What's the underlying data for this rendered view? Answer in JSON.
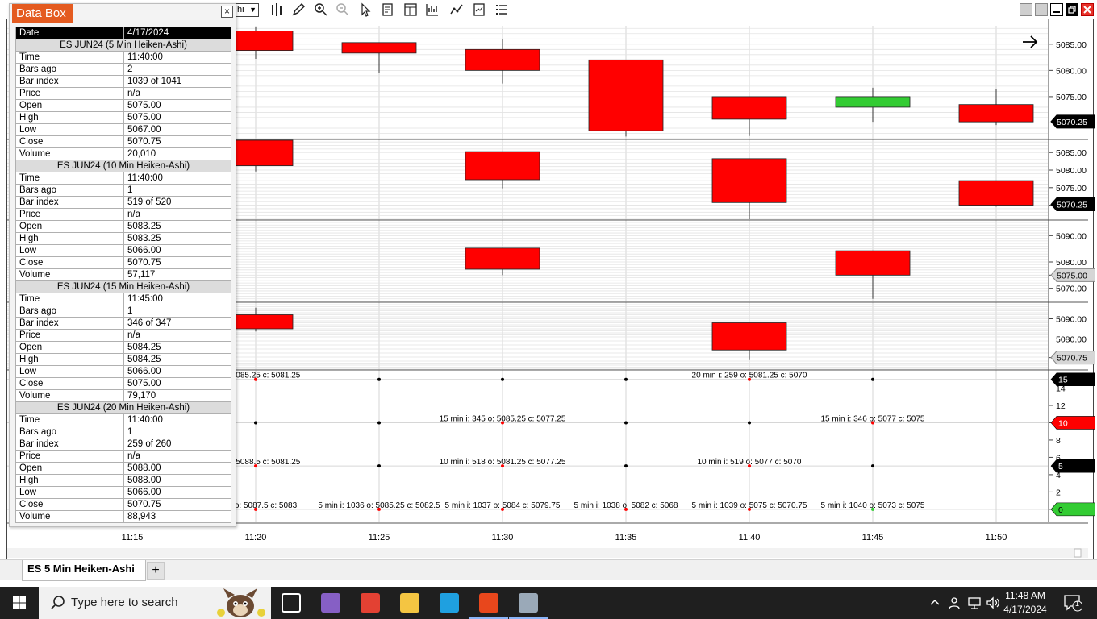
{
  "toolbar": {
    "select_value": "hi",
    "icons": [
      "bar-chart-icon",
      "pencil-icon",
      "zoom-in-icon",
      "zoom-out-icon",
      "pointer-icon",
      "properties-icon",
      "templates-icon",
      "strategy-icon",
      "indicator-icon",
      "data-box-icon",
      "list-icon"
    ],
    "window_buttons": [
      "restore-icon",
      "restore-icon",
      "minimize-icon",
      "maximize-icon",
      "close-icon"
    ]
  },
  "databox": {
    "title": "Data Box",
    "close_glyph": "×",
    "header": {
      "label": "Date",
      "value": "4/17/2024"
    },
    "sections": [
      {
        "title": "ES JUN24 (5 Min Heiken-Ashi)",
        "rows": [
          [
            "Time",
            "11:40:00"
          ],
          [
            "Bars ago",
            "2"
          ],
          [
            "Bar index",
            "1039 of 1041"
          ],
          [
            "Price",
            "n/a"
          ],
          [
            "Open",
            "5075.00"
          ],
          [
            "High",
            "5075.00"
          ],
          [
            "Low",
            "5067.00"
          ],
          [
            "Close",
            "5070.75"
          ],
          [
            "Volume",
            "20,010"
          ]
        ]
      },
      {
        "title": "ES JUN24 (10 Min Heiken-Ashi)",
        "rows": [
          [
            "Time",
            "11:40:00"
          ],
          [
            "Bars ago",
            "1"
          ],
          [
            "Bar index",
            "519 of 520"
          ],
          [
            "Price",
            "n/a"
          ],
          [
            "Open",
            "5083.25"
          ],
          [
            "High",
            "5083.25"
          ],
          [
            "Low",
            "5066.00"
          ],
          [
            "Close",
            "5070.75"
          ],
          [
            "Volume",
            "57,117"
          ]
        ]
      },
      {
        "title": "ES JUN24 (15 Min Heiken-Ashi)",
        "rows": [
          [
            "Time",
            "11:45:00"
          ],
          [
            "Bars ago",
            "1"
          ],
          [
            "Bar index",
            "346 of 347"
          ],
          [
            "Price",
            "n/a"
          ],
          [
            "Open",
            "5084.25"
          ],
          [
            "High",
            "5084.25"
          ],
          [
            "Low",
            "5066.00"
          ],
          [
            "Close",
            "5075.00"
          ],
          [
            "Volume",
            "79,170"
          ]
        ]
      },
      {
        "title": "ES JUN24 (20 Min Heiken-Ashi)",
        "rows": [
          [
            "Time",
            "11:40:00"
          ],
          [
            "Bars ago",
            "1"
          ],
          [
            "Bar index",
            "259 of 260"
          ],
          [
            "Price",
            "n/a"
          ],
          [
            "Open",
            "5088.00"
          ],
          [
            "High",
            "5088.00"
          ],
          [
            "Low",
            "5066.00"
          ],
          [
            "Close",
            "5070.75"
          ],
          [
            "Volume",
            "88,943"
          ]
        ]
      }
    ]
  },
  "chart_data": {
    "type": "candlestick",
    "x_labels": [
      "11:15",
      "11:20",
      "11:25",
      "11:30",
      "11:35",
      "11:40",
      "11:45",
      "11:50"
    ],
    "colors": {
      "up": "#33cc33",
      "down": "#ff0000",
      "grid": "#d0d0d0"
    },
    "panels": [
      {
        "name": "5 min",
        "ylim": [
          5067,
          5088.5
        ],
        "ticks": [
          "5085.00",
          "5080.00",
          "5075.00",
          "5070.00"
        ],
        "tick_values": [
          5085,
          5080,
          5075,
          5070
        ],
        "price_tag": "5070.25",
        "price_value": 5070.25,
        "tag_style": "black",
        "candles": [
          {
            "t": "11:20",
            "open": 5087.5,
            "close": 5083.8,
            "high": 5088.3,
            "low": 5082.2
          },
          {
            "t": "11:25",
            "open": 5085.3,
            "close": 5083.3,
            "high": 5085.3,
            "low": 5079.6
          },
          {
            "t": "11:30",
            "open": 5084.0,
            "close": 5080.0,
            "high": 5085.9,
            "low": 5077.5
          },
          {
            "t": "11:35",
            "open": 5082.0,
            "close": 5068.5,
            "high": 5082.0,
            "low": 5067.4
          },
          {
            "t": "11:40",
            "open": 5075.0,
            "close": 5070.7,
            "high": 5075.0,
            "low": 5067.5
          },
          {
            "t": "11:45",
            "open": 5073.0,
            "close": 5075.0,
            "high": 5076.7,
            "low": 5070.2
          },
          {
            "t": "11:50",
            "open": 5073.5,
            "close": 5070.2,
            "high": 5076.4,
            "low": 5069.6
          }
        ]
      },
      {
        "name": "10 min",
        "ylim": [
          5066,
          5088.5
        ],
        "ticks": [
          "5085.00",
          "5080.00",
          "5075.00",
          "5070.00"
        ],
        "tick_values": [
          5085,
          5080,
          5075,
          5070
        ],
        "price_tag": "5070.25",
        "price_value": 5070.25,
        "tag_style": "black",
        "candles": [
          {
            "t": "11:20",
            "open": 5088.5,
            "close": 5081.25,
            "high": 5088.5,
            "low": 5079.6
          },
          {
            "t": "11:30",
            "open": 5085.25,
            "close": 5077.25,
            "high": 5085.25,
            "low": 5074.8
          },
          {
            "t": "11:40",
            "open": 5083.25,
            "close": 5070.75,
            "high": 5083.25,
            "low": 5066.0
          },
          {
            "t": "11:50",
            "open": 5077.0,
            "close": 5070.0,
            "high": 5077.0,
            "low": 5069.6
          }
        ]
      },
      {
        "name": "15 min",
        "ylim": [
          5065,
          5095
        ],
        "ticks": [
          "5090.00",
          "5080.00",
          "5075.00",
          "5070.00"
        ],
        "tick_values": [
          5090,
          5080,
          5075,
          5070
        ],
        "price_tag": "5075.00",
        "price_value": 5075.0,
        "tag_style": "grey",
        "candles": [
          {
            "t": "11:30",
            "open": 5085.25,
            "close": 5077.25,
            "high": 5085.25,
            "low": 5075.0
          },
          {
            "t": "11:45",
            "open": 5084.25,
            "close": 5075.0,
            "high": 5084.25,
            "low": 5066.0
          }
        ]
      },
      {
        "name": "20 min",
        "ylim": [
          5065,
          5097
        ],
        "ticks": [
          "5090.00",
          "5080.00",
          "5070.75"
        ],
        "tick_values": [
          5090,
          5080,
          5070.75
        ],
        "price_tag": "5070.75",
        "price_value": 5070.75,
        "tag_style": "grey",
        "candles": [
          {
            "t": "11:20",
            "open": 5092.0,
            "close": 5085.0,
            "high": 5095.5,
            "low": 5083.7
          },
          {
            "t": "11:40",
            "open": 5088.0,
            "close": 5074.5,
            "high": 5088.0,
            "low": 5069.5
          }
        ]
      }
    ],
    "indicator": {
      "ylim": [
        -1.5,
        16
      ],
      "ticks": [
        "14",
        "12",
        "10",
        "8",
        "6",
        "4",
        "2",
        "0"
      ],
      "tick_values": [
        14,
        12,
        10,
        8,
        6,
        4,
        2,
        0
      ],
      "badges": [
        {
          "label": "15",
          "value": 15,
          "color": "#000000",
          "text": "#ffffff"
        },
        {
          "label": "10",
          "value": 10,
          "color": "#ff0000",
          "text": "#ffffff"
        },
        {
          "label": "5",
          "value": 5,
          "color": "#000000",
          "text": "#ffffff"
        },
        {
          "label": "0",
          "value": 0,
          "color": "#33cc33",
          "text": "#000000"
        }
      ],
      "rows": [
        15,
        10,
        5,
        0
      ],
      "dots": [
        {
          "t": "11:20",
          "level": 15,
          "color": "red"
        },
        {
          "t": "11:25",
          "level": 15,
          "color": "black"
        },
        {
          "t": "11:30",
          "level": 15,
          "color": "black"
        },
        {
          "t": "11:35",
          "level": 15,
          "color": "black"
        },
        {
          "t": "11:40",
          "level": 15,
          "color": "red"
        },
        {
          "t": "11:45",
          "level": 15,
          "color": "black"
        },
        {
          "t": "11:20",
          "level": 10,
          "color": "black"
        },
        {
          "t": "11:25",
          "level": 10,
          "color": "black"
        },
        {
          "t": "11:30",
          "level": 10,
          "color": "red"
        },
        {
          "t": "11:35",
          "level": 10,
          "color": "black"
        },
        {
          "t": "11:40",
          "level": 10,
          "color": "black"
        },
        {
          "t": "11:45",
          "level": 10,
          "color": "red"
        },
        {
          "t": "11:20",
          "level": 5,
          "color": "red"
        },
        {
          "t": "11:25",
          "level": 5,
          "color": "black"
        },
        {
          "t": "11:30",
          "level": 5,
          "color": "red"
        },
        {
          "t": "11:35",
          "level": 5,
          "color": "black"
        },
        {
          "t": "11:40",
          "level": 5,
          "color": "red"
        },
        {
          "t": "11:45",
          "level": 5,
          "color": "black"
        },
        {
          "t": "11:20",
          "level": 0,
          "color": "red"
        },
        {
          "t": "11:25",
          "level": 0,
          "color": "red"
        },
        {
          "t": "11:30",
          "level": 0,
          "color": "red"
        },
        {
          "t": "11:35",
          "level": 0,
          "color": "red"
        },
        {
          "t": "11:40",
          "level": 0,
          "color": "red"
        },
        {
          "t": "11:45",
          "level": 0,
          "color": "green"
        }
      ],
      "labels": [
        {
          "t": "11:20",
          "level": 15,
          "text": "58 o: 5085.25 c: 5081.25"
        },
        {
          "t": "11:40",
          "level": 15,
          "text": "20 min i: 259 o: 5081.25 c: 5070"
        },
        {
          "t": "11:30",
          "level": 10,
          "text": "15 min i: 345 o: 5085.25 c: 5077.25"
        },
        {
          "t": "11:45",
          "level": 10,
          "text": "15 min i: 346 o: 5077 c: 5075"
        },
        {
          "t": "11:20",
          "level": 5,
          "text": "517 o: 5088.5 c: 5081.25"
        },
        {
          "t": "11:30",
          "level": 5,
          "text": "10 min i: 518 o: 5081.25 c: 5077.25"
        },
        {
          "t": "11:40",
          "level": 5,
          "text": "10 min i: 519 o: 5077 c: 5070"
        },
        {
          "t": "11:20",
          "level": 0,
          "text": "1035 o: 5087.5 c: 5083"
        },
        {
          "t": "11:25",
          "level": 0,
          "text": "5 min i: 1036 o: 5085.25 c: 5082.5"
        },
        {
          "t": "11:30",
          "level": 0,
          "text": "5 min i: 1037 o: 5084 c: 5079.75"
        },
        {
          "t": "11:35",
          "level": 0,
          "text": "5 min i: 1038 o: 5082 c: 5068"
        },
        {
          "t": "11:40",
          "level": 0,
          "text": "5 min i: 1039 o: 5075 c: 5070.75"
        },
        {
          "t": "11:45",
          "level": 0,
          "text": "5 min i: 1040 o: 5073 c: 5075"
        }
      ]
    }
  },
  "tabs": {
    "active": "ES 5 Min Heiken-Ashi",
    "add_glyph": "+"
  },
  "taskbar": {
    "search_placeholder": "Type here to search",
    "time": "11:48 AM",
    "date": "4/17/2024",
    "notification_count": "1",
    "apps": [
      "task-view-icon",
      "visual-studio-icon",
      "chrome-icon",
      "file-explorer-icon",
      "edge-icon",
      "ninjatrader-icon",
      "control-panel-icon"
    ],
    "app_colors": [
      "#ffffff",
      "#865fc5",
      "#e34133",
      "#f4c542",
      "#1fa0e0",
      "#e8471c",
      "#9aa9b8"
    ]
  }
}
